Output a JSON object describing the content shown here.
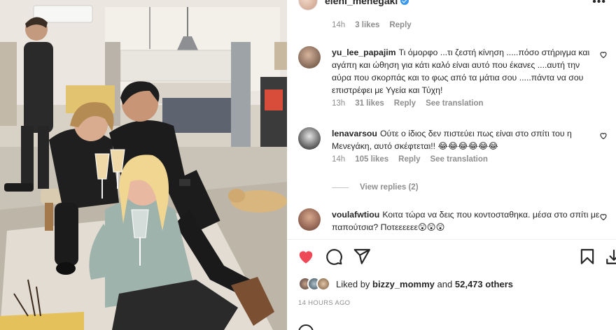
{
  "post": {
    "username": "eleni_menegaki",
    "verified": true,
    "photo_alt": "Friends celebrating with drinks in a kitchen"
  },
  "top_meta": {
    "time": "14h",
    "likes": "3 likes",
    "reply": "Reply"
  },
  "comments": [
    {
      "username": "yu_lee_papajim",
      "text": "Τι όμορφο ...τι ζεστή κίνηση .....πόσο στήριγμα και αγάπη και ώθηση για κάτι καλό είναι αυτό που έκανες ....αυτή την αύρα που σκορπάς και το φως από τα μάτια σου .....πάντα να σου επιστρέφει με Υγεία και Τύχη!",
      "time": "13h",
      "likes": "31 likes",
      "reply": "Reply",
      "translate": "See translation"
    },
    {
      "username": "lenavarsou",
      "text": "Ούτε ο ίδιος δεν πιστεύει πως είναι στο σπίτι του η Μενεγάκη, αυτό σκέφτεται!! 😂😂😂😂😂😂",
      "time": "14h",
      "likes": "105 likes",
      "reply": "Reply",
      "translate": "See translation",
      "view_replies": "View replies (2)"
    },
    {
      "username": "voulafwtiou",
      "text": "Κοιτα τώρα να δεις που κοντοσταθηκα. μέσα στο σπίτι με παπούτσια? Ποτεεεεεε😲😲😲"
    }
  ],
  "likes_line": {
    "prefix": "Liked by",
    "user": "bizzy_mommy",
    "middle": "and",
    "count": "52,473 others"
  },
  "timestamp": "14 HOURS AGO",
  "colors": {
    "like_red": "#ed4956",
    "meta_gray": "#8e8e8e",
    "text": "#262626",
    "divider": "#efefef"
  },
  "icons": [
    "heart-filled-icon",
    "comment-icon",
    "share-icon",
    "bookmark-icon",
    "download-icon",
    "heart-outline-icon"
  ]
}
